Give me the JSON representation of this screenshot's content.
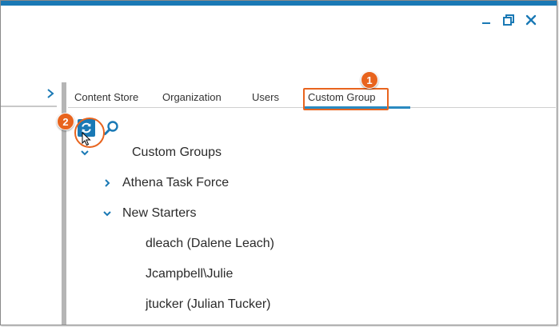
{
  "window": {
    "controls": {
      "minimize_icon": "minimize-icon",
      "restore_icon": "restore-icon",
      "close_icon": "close-icon"
    },
    "accent_color": "#1a79b5",
    "highlight_color": "#e8641e"
  },
  "tabs": [
    {
      "label": "Content Store",
      "active": false
    },
    {
      "label": "Organization",
      "active": false
    },
    {
      "label": "Users",
      "active": false
    },
    {
      "label": "Custom Group",
      "active": true
    }
  ],
  "callouts": {
    "one": "1",
    "two": "2"
  },
  "toolbar": {
    "refresh_icon": "refresh-icon",
    "search_icon": "search-icon"
  },
  "tree": {
    "root": {
      "label": "Custom Groups",
      "expanded": true
    },
    "groups": [
      {
        "label": "Athena Task Force",
        "expanded": false
      },
      {
        "label": "New Starters",
        "expanded": true,
        "members": [
          {
            "label": "dleach (Dalene Leach)"
          },
          {
            "label": "Jcampbell\\Julie"
          },
          {
            "label": "jtucker (Julian Tucker)"
          }
        ]
      }
    ]
  }
}
